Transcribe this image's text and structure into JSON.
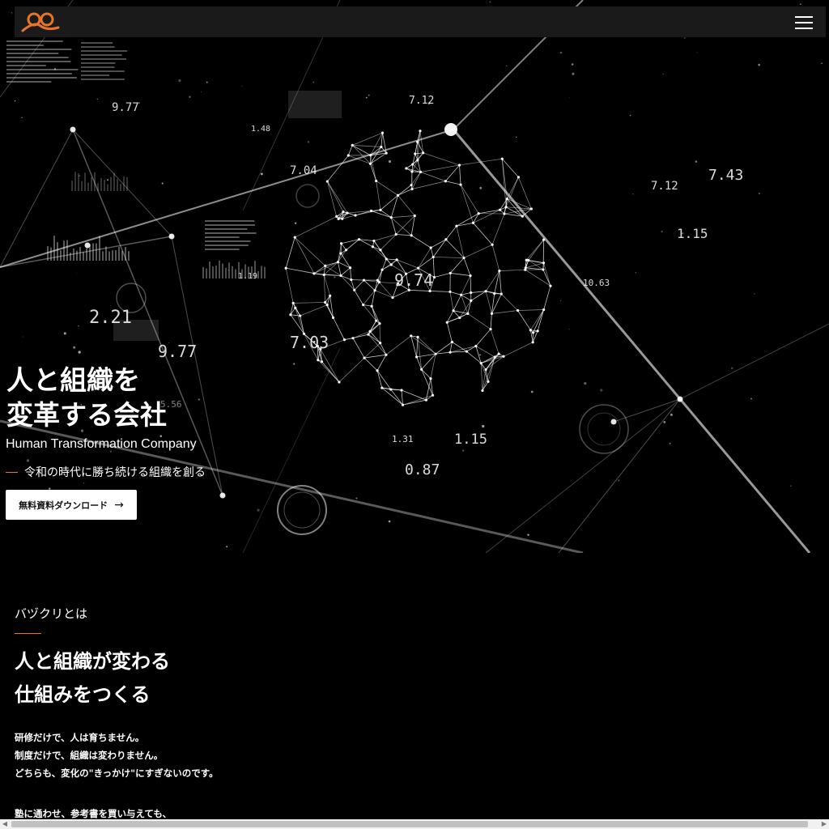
{
  "header": {
    "logo_icon": "bazukuri-logo",
    "menu_icon": "hamburger-menu-icon"
  },
  "hero": {
    "title_lines": [
      "人と組織を",
      "変革する会社"
    ],
    "subtitle": "Human Transformation Company",
    "tagline": "令和の時代に勝ち続ける組織を創る",
    "download_label": "無料資料ダウンロード",
    "download_arrow": "→",
    "numbers": [
      "9.77",
      "1.48",
      "7.12",
      "7.04",
      "7.12",
      "7.43",
      "1.15",
      "1.19",
      "9.74",
      "10.63",
      "2.21",
      "9.77",
      "7.03",
      "1.31",
      "1.15",
      "0.87",
      "5.56"
    ]
  },
  "about": {
    "label": "バヅクリとは",
    "heading_lines": [
      "人と組織が変わる",
      "仕組みをつくる"
    ],
    "body_lines": [
      "研修だけで、人は育ちません。",
      "制度だけで、組織は変わりません。",
      "どちらも、変化の\"きっかけ\"にすぎないのです。",
      "",
      "塾に通わせ、参考書を買い与えても、"
    ]
  },
  "colors": {
    "accent": "#e8742a",
    "background": "#000000",
    "header_bg": "#1a1a1a"
  }
}
